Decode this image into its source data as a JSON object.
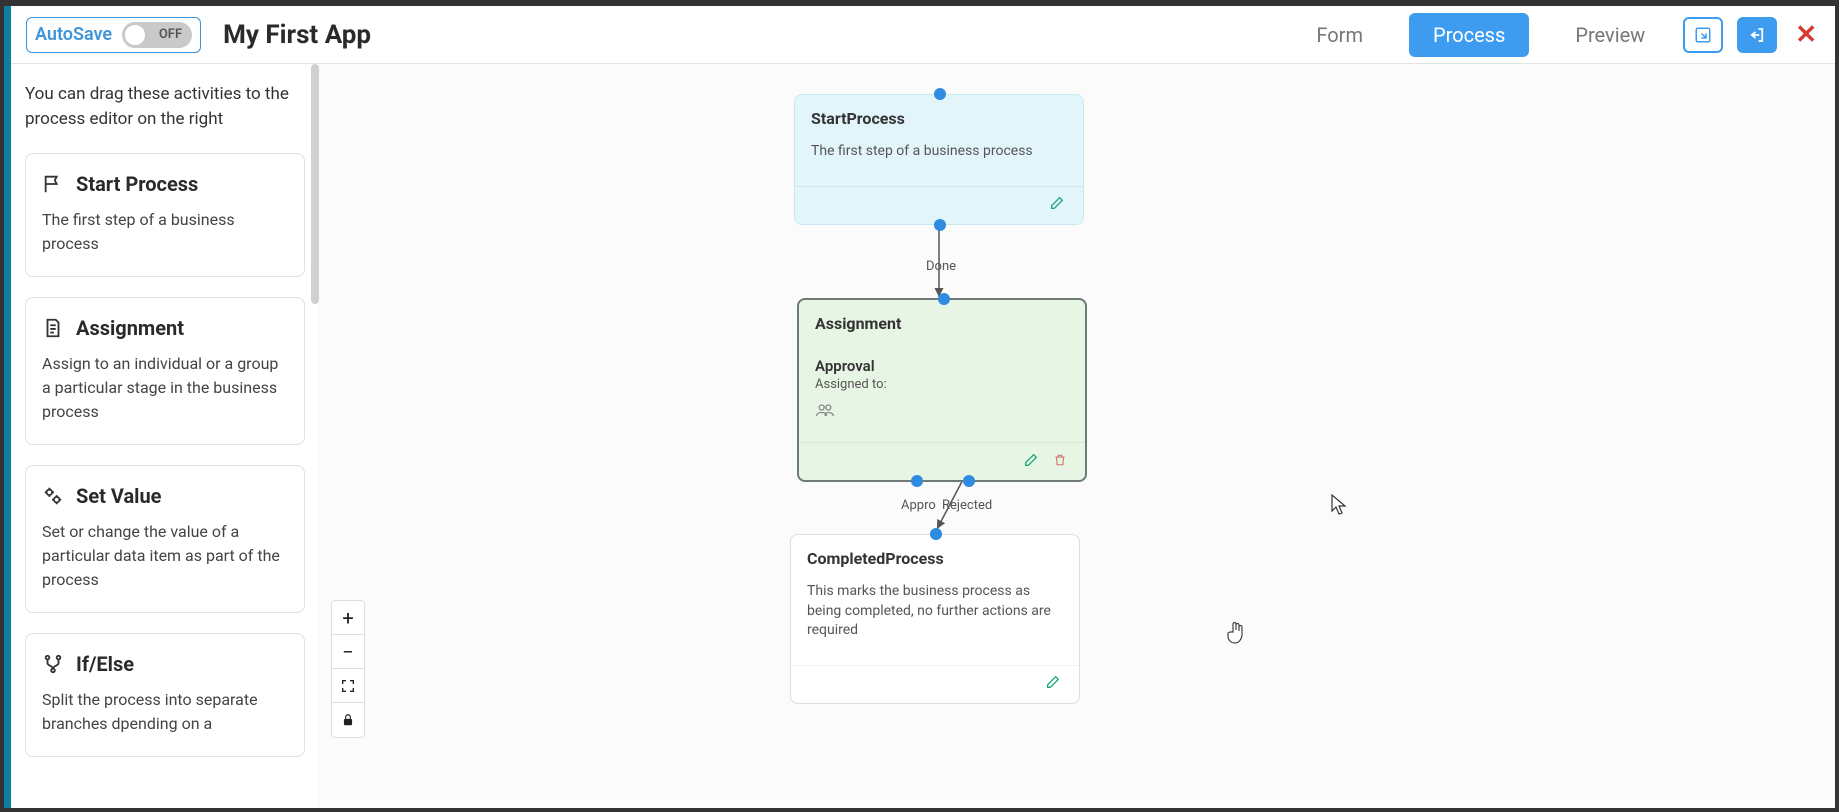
{
  "header": {
    "autosave_label": "AutoSave",
    "autosave_state": "OFF",
    "app_title": "My First App",
    "tabs": [
      {
        "label": "Form"
      },
      {
        "label": "Process"
      },
      {
        "label": "Preview"
      }
    ],
    "active_tab": "Process",
    "close_symbol": "✕"
  },
  "sidebar": {
    "hint": "You can drag these activities to the process editor on the right",
    "activities": [
      {
        "title": "Start Process",
        "desc": "The first step of a business process",
        "icon": "flag-icon"
      },
      {
        "title": "Assignment",
        "desc": "Assign to an individual or a group a particular stage in the business process",
        "icon": "document-icon"
      },
      {
        "title": "Set Value",
        "desc": "Set or change the value of a particular data item as part of the process",
        "icon": "gears-icon"
      },
      {
        "title": "If/Else",
        "desc": "Split the process into separate branches dpending on a",
        "icon": "branch-icon"
      }
    ]
  },
  "canvas": {
    "nodes": {
      "start": {
        "title": "StartProcess",
        "desc": "The first step of a business process"
      },
      "assignment": {
        "title": "Assignment",
        "sub": "Approval",
        "assigned_label": "Assigned to:"
      },
      "completed": {
        "title": "CompletedProcess",
        "desc": "This marks the business process as being completed, no further actions are required"
      }
    },
    "edges": {
      "done": "Done",
      "approved": "Appro",
      "rejected": "Rejected"
    }
  },
  "zoom": {
    "plus": "+",
    "minus": "−"
  }
}
